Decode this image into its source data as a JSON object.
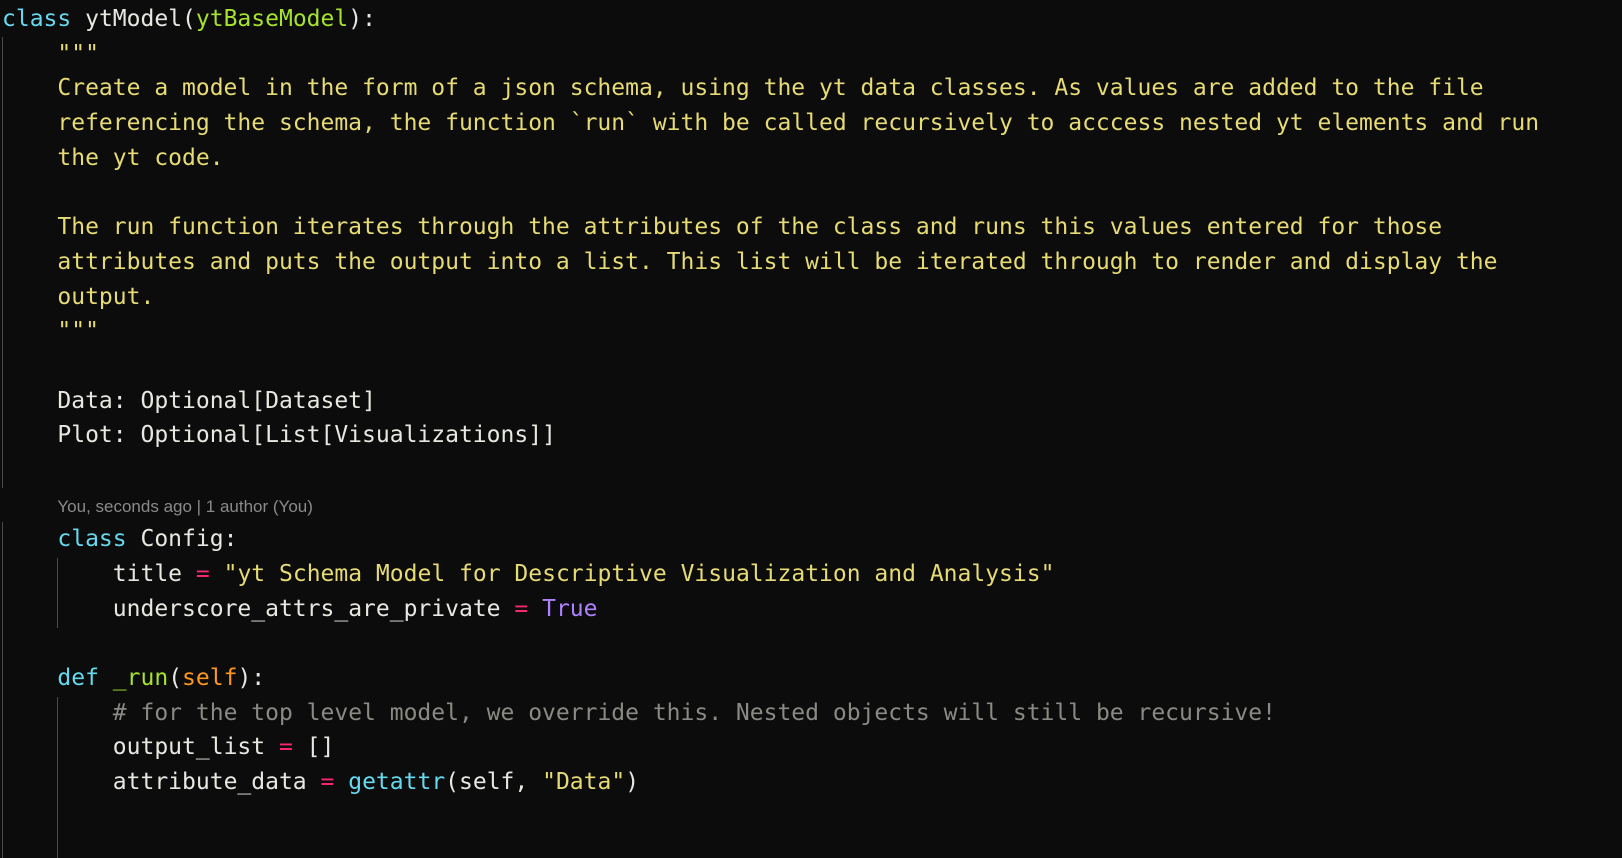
{
  "editor": {
    "theme_colors": {
      "background": "#0c0c0c",
      "keyword": "#66d9ef",
      "class_name": "#a6e22e",
      "string": "#e6db74",
      "operator": "#f92672",
      "constant": "#ae81ff",
      "self": "#fd971f",
      "comment": "#8a8a84"
    },
    "lines": [
      {
        "indent": 0,
        "tokens": [
          [
            "kw",
            "class"
          ],
          [
            "",
            "  "
          ],
          [
            "",
            "ytModel("
          ],
          [
            "cls",
            "ytBaseModel"
          ],
          [
            "",
            "):"
          ]
        ]
      },
      {
        "indent": 1,
        "tokens": [
          [
            "str",
            "\"\"\""
          ]
        ]
      },
      {
        "indent": 1,
        "tokens": [
          [
            "str",
            "Create a model in the form of a json schema, using the yt data classes. As values are added to the file"
          ]
        ]
      },
      {
        "indent": 1,
        "tokens": [
          [
            "str",
            "referencing the schema, the function `run` with be called recursively to acccess nested yt elements and run"
          ]
        ]
      },
      {
        "indent": 1,
        "tokens": [
          [
            "str",
            "the yt code."
          ]
        ]
      },
      {
        "indent": 1,
        "tokens": []
      },
      {
        "indent": 1,
        "tokens": [
          [
            "str",
            "The run function iterates through the attributes of the class and runs this values entered for those"
          ]
        ]
      },
      {
        "indent": 1,
        "tokens": [
          [
            "str",
            "attributes and puts the output into a list. This list will be iterated through to render and display the"
          ]
        ]
      },
      {
        "indent": 1,
        "tokens": [
          [
            "str",
            "output."
          ]
        ]
      },
      {
        "indent": 1,
        "tokens": [
          [
            "str",
            "\"\"\""
          ]
        ]
      },
      {
        "indent": 1,
        "tokens": []
      },
      {
        "indent": 1,
        "tokens": [
          [
            "",
            "Data: Optional[Dataset]"
          ]
        ]
      },
      {
        "indent": 1,
        "tokens": [
          [
            "",
            "Plot: Optional[List[Visualizations]]"
          ]
        ]
      },
      {
        "indent": 1,
        "tokens": []
      },
      {
        "indent": 1,
        "blame": "You, seconds ago | 1 author (You)",
        "tokens": []
      },
      {
        "indent": 1,
        "tokens": [
          [
            "kw",
            "class"
          ],
          [
            "",
            " Config:"
          ]
        ]
      },
      {
        "indent": 2,
        "tokens": [
          [
            "",
            "title "
          ],
          [
            "op",
            "="
          ],
          [
            "",
            " "
          ],
          [
            "str",
            "\"yt Schema Model for Descriptive Visualization and Analysis\""
          ]
        ]
      },
      {
        "indent": 2,
        "tokens": [
          [
            "",
            "underscore_attrs_are_private "
          ],
          [
            "op",
            "="
          ],
          [
            "",
            " "
          ],
          [
            "const",
            "True"
          ]
        ]
      },
      {
        "indent": 1,
        "tokens": []
      },
      {
        "indent": 1,
        "tokens": [
          [
            "kw",
            "def"
          ],
          [
            "",
            " "
          ],
          [
            "fn",
            "_run"
          ],
          [
            "",
            "("
          ],
          [
            "self",
            "self"
          ],
          [
            "",
            "):"
          ]
        ]
      },
      {
        "indent": 2,
        "tokens": [
          [
            "cm",
            "# for the top level model, we override this. Nested objects will still be recursive!"
          ]
        ]
      },
      {
        "indent": 2,
        "tokens": [
          [
            "",
            "output_list "
          ],
          [
            "op",
            "="
          ],
          [
            "",
            " []"
          ]
        ]
      },
      {
        "indent": 2,
        "tokens": [
          [
            "",
            "attribute_data "
          ],
          [
            "op",
            "="
          ],
          [
            "",
            " "
          ],
          [
            "bi",
            "getattr"
          ],
          [
            "",
            "(self, "
          ],
          [
            "str",
            "\"Data\""
          ],
          [
            "",
            ")"
          ]
        ]
      },
      {
        "indent": 2,
        "tokens": []
      }
    ]
  }
}
